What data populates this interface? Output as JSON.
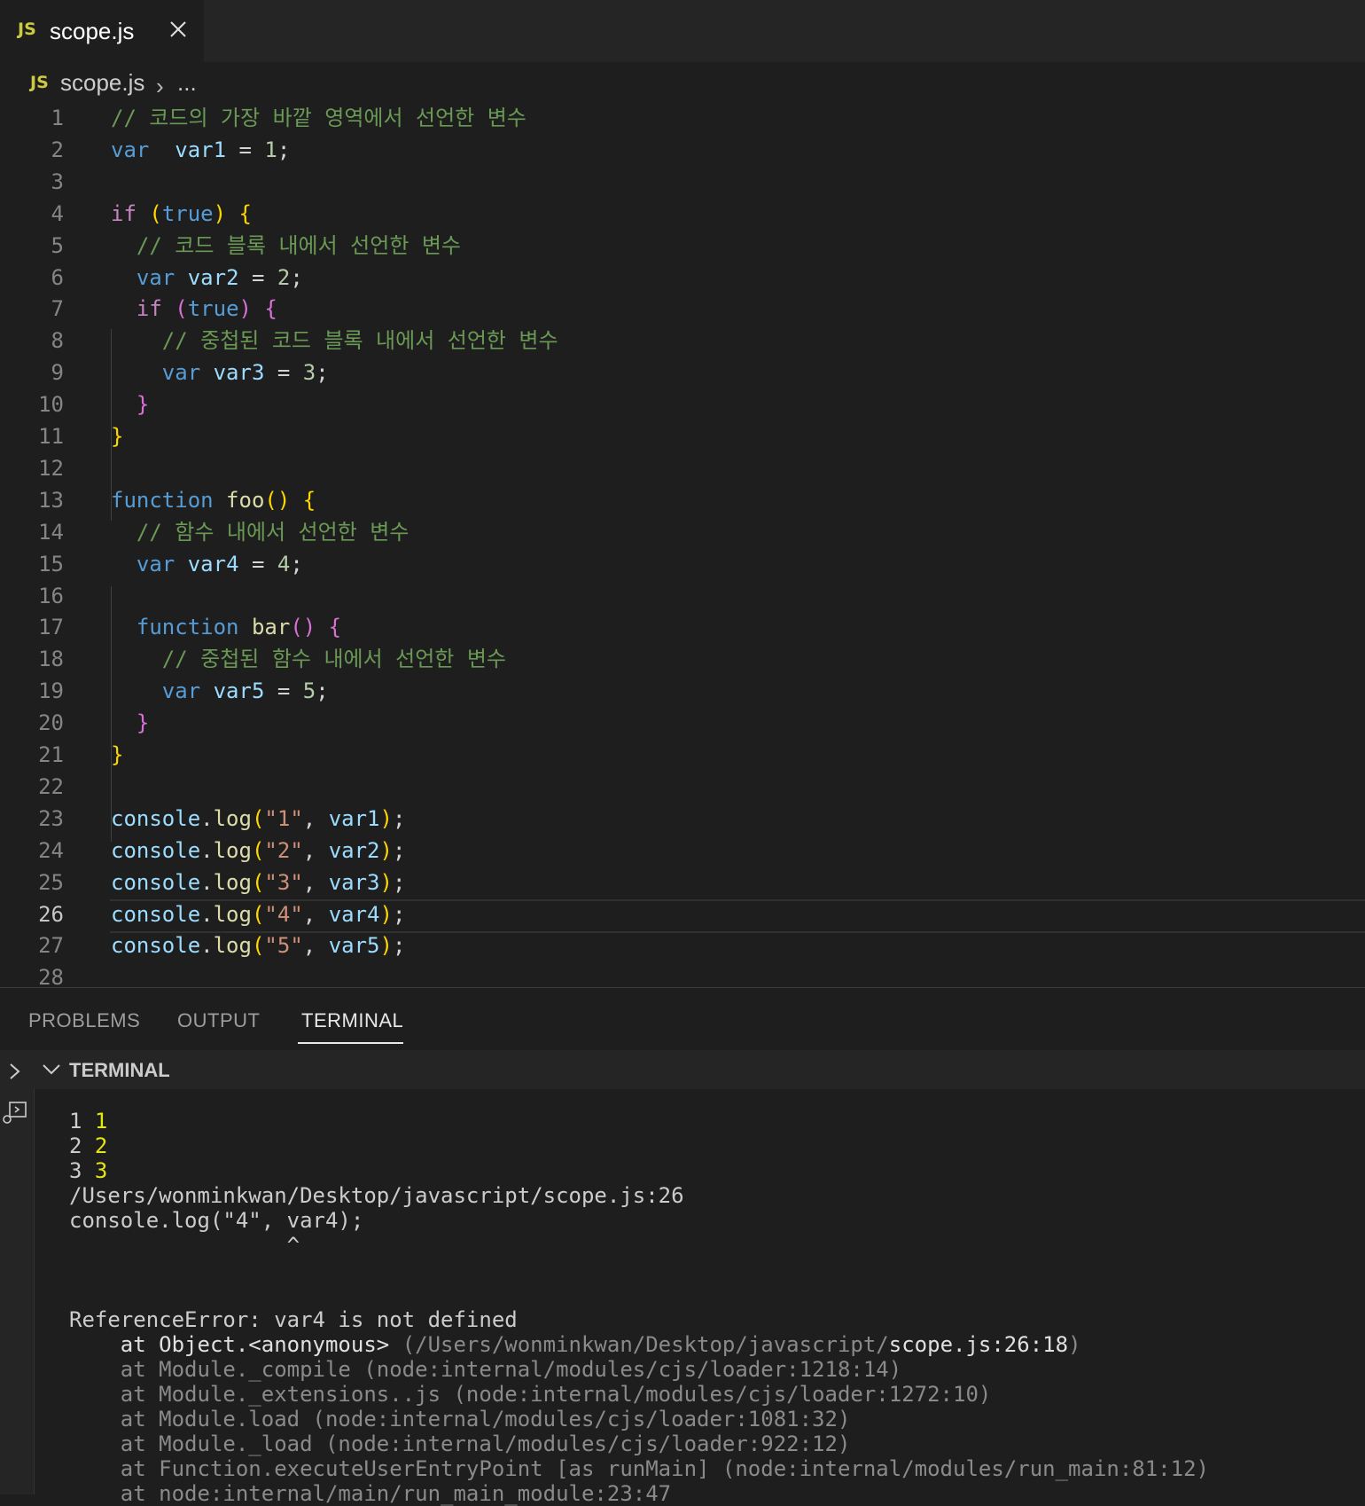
{
  "tab": {
    "badge": "JS",
    "filename": "scope.js"
  },
  "breadcrumb": {
    "badge": "JS",
    "file": "scope.js",
    "chevron": "›",
    "ellipsis": "..."
  },
  "editor": {
    "active_line": 26,
    "lines": [
      {
        "n": "1",
        "segs": [
          [
            "cm",
            "// 코드의 가장 바깥 영역에서 선언한 변수"
          ]
        ]
      },
      {
        "n": "2",
        "segs": [
          [
            "kw",
            "var"
          ],
          [
            "",
            "  "
          ],
          [
            "vr",
            "var1"
          ],
          [
            "",
            " = "
          ],
          [
            "nm",
            "1"
          ],
          [
            "",
            ";"
          ]
        ]
      },
      {
        "n": "3",
        "segs": []
      },
      {
        "n": "4",
        "segs": [
          [
            "ctl",
            "if"
          ],
          [
            "",
            " "
          ],
          [
            "b1",
            "("
          ],
          [
            "kw",
            "true"
          ],
          [
            "b1",
            ")"
          ],
          [
            "",
            " "
          ],
          [
            "b1",
            "{"
          ]
        ]
      },
      {
        "n": "5",
        "segs": [
          [
            "",
            "  "
          ],
          [
            "cm",
            "// 코드 블록 내에서 선언한 변수"
          ]
        ]
      },
      {
        "n": "6",
        "segs": [
          [
            "",
            "  "
          ],
          [
            "kw",
            "var"
          ],
          [
            "",
            " "
          ],
          [
            "vr",
            "var2"
          ],
          [
            "",
            " = "
          ],
          [
            "nm",
            "2"
          ],
          [
            "",
            ";"
          ]
        ]
      },
      {
        "n": "7",
        "segs": [
          [
            "",
            "  "
          ],
          [
            "ctl",
            "if"
          ],
          [
            "",
            " "
          ],
          [
            "b2",
            "("
          ],
          [
            "kw",
            "true"
          ],
          [
            "b2",
            ")"
          ],
          [
            "",
            " "
          ],
          [
            "b2",
            "{"
          ]
        ]
      },
      {
        "n": "8",
        "segs": [
          [
            "",
            "    "
          ],
          [
            "cm",
            "// 중첩된 코드 블록 내에서 선언한 변수"
          ]
        ]
      },
      {
        "n": "9",
        "segs": [
          [
            "",
            "    "
          ],
          [
            "kw",
            "var"
          ],
          [
            "",
            " "
          ],
          [
            "vr",
            "var3"
          ],
          [
            "",
            " = "
          ],
          [
            "nm",
            "3"
          ],
          [
            "",
            ";"
          ]
        ]
      },
      {
        "n": "10",
        "segs": [
          [
            "",
            "  "
          ],
          [
            "b2",
            "}"
          ]
        ]
      },
      {
        "n": "11",
        "segs": [
          [
            "b1",
            "}"
          ]
        ]
      },
      {
        "n": "12",
        "segs": []
      },
      {
        "n": "13",
        "segs": [
          [
            "kw",
            "function"
          ],
          [
            "",
            " "
          ],
          [
            "fn",
            "foo"
          ],
          [
            "b1",
            "()"
          ],
          [
            "",
            " "
          ],
          [
            "b1",
            "{"
          ]
        ]
      },
      {
        "n": "14",
        "segs": [
          [
            "",
            "  "
          ],
          [
            "cm",
            "// 함수 내에서 선언한 변수"
          ]
        ]
      },
      {
        "n": "15",
        "segs": [
          [
            "",
            "  "
          ],
          [
            "kw",
            "var"
          ],
          [
            "",
            " "
          ],
          [
            "vr",
            "var4"
          ],
          [
            "",
            " = "
          ],
          [
            "nm",
            "4"
          ],
          [
            "",
            ";"
          ]
        ]
      },
      {
        "n": "16",
        "segs": []
      },
      {
        "n": "17",
        "segs": [
          [
            "",
            "  "
          ],
          [
            "kw",
            "function"
          ],
          [
            "",
            " "
          ],
          [
            "fn",
            "bar"
          ],
          [
            "b2",
            "()"
          ],
          [
            "",
            " "
          ],
          [
            "b2",
            "{"
          ]
        ]
      },
      {
        "n": "18",
        "segs": [
          [
            "",
            "    "
          ],
          [
            "cm",
            "// 중첩된 함수 내에서 선언한 변수"
          ]
        ]
      },
      {
        "n": "19",
        "segs": [
          [
            "",
            "    "
          ],
          [
            "kw",
            "var"
          ],
          [
            "",
            " "
          ],
          [
            "vr",
            "var5"
          ],
          [
            "",
            " = "
          ],
          [
            "nm",
            "5"
          ],
          [
            "",
            ";"
          ]
        ]
      },
      {
        "n": "20",
        "segs": [
          [
            "",
            "  "
          ],
          [
            "b2",
            "}"
          ]
        ]
      },
      {
        "n": "21",
        "segs": [
          [
            "b1",
            "}"
          ]
        ]
      },
      {
        "n": "22",
        "segs": []
      },
      {
        "n": "23",
        "segs": [
          [
            "vr",
            "console"
          ],
          [
            "",
            "."
          ],
          [
            "fn",
            "log"
          ],
          [
            "b1",
            "("
          ],
          [
            "str",
            "\"1\""
          ],
          [
            "",
            ", "
          ],
          [
            "vr",
            "var1"
          ],
          [
            "b1",
            ")"
          ],
          [
            "",
            ";"
          ]
        ]
      },
      {
        "n": "24",
        "segs": [
          [
            "vr",
            "console"
          ],
          [
            "",
            "."
          ],
          [
            "fn",
            "log"
          ],
          [
            "b1",
            "("
          ],
          [
            "str",
            "\"2\""
          ],
          [
            "",
            ", "
          ],
          [
            "vr",
            "var2"
          ],
          [
            "b1",
            ")"
          ],
          [
            "",
            ";"
          ]
        ]
      },
      {
        "n": "25",
        "segs": [
          [
            "vr",
            "console"
          ],
          [
            "",
            "."
          ],
          [
            "fn",
            "log"
          ],
          [
            "b1",
            "("
          ],
          [
            "str",
            "\"3\""
          ],
          [
            "",
            ", "
          ],
          [
            "vr",
            "var3"
          ],
          [
            "b1",
            ")"
          ],
          [
            "",
            ";"
          ]
        ]
      },
      {
        "n": "26",
        "segs": [
          [
            "vr",
            "console"
          ],
          [
            "",
            "."
          ],
          [
            "fn",
            "log"
          ],
          [
            "b1",
            "("
          ],
          [
            "str",
            "\"4\""
          ],
          [
            "",
            ", "
          ],
          [
            "vr",
            "var4"
          ],
          [
            "b1",
            ")"
          ],
          [
            "",
            ";"
          ]
        ]
      },
      {
        "n": "27",
        "segs": [
          [
            "vr",
            "console"
          ],
          [
            "",
            "."
          ],
          [
            "fn",
            "log"
          ],
          [
            "b1",
            "("
          ],
          [
            "str",
            "\"5\""
          ],
          [
            "",
            ", "
          ],
          [
            "vr",
            "var5"
          ],
          [
            "b1",
            ")"
          ],
          [
            "",
            ";"
          ]
        ]
      },
      {
        "n": "28",
        "segs": []
      }
    ]
  },
  "panel": {
    "tabs": [
      "PROBLEMS",
      "OUTPUT",
      "TERMINAL"
    ],
    "active_tab": "TERMINAL",
    "terminal_header": "TERMINAL"
  },
  "terminal": {
    "lines": [
      [
        [
          "",
          "1 "
        ],
        [
          "yl",
          "1"
        ]
      ],
      [
        [
          "",
          "2 "
        ],
        [
          "yl",
          "2"
        ]
      ],
      [
        [
          "",
          "3 "
        ],
        [
          "yl",
          "3"
        ]
      ],
      [
        [
          "",
          "/Users/wonminkwan/Desktop/javascript/scope.js:26"
        ]
      ],
      [
        [
          "",
          "console.log(\"4\", var4);"
        ]
      ],
      [
        [
          "",
          "                 ^"
        ]
      ],
      [],
      [],
      [
        [
          "",
          "ReferenceError: var4 is not defined"
        ]
      ],
      [
        [
          "white",
          "    at Object.<anonymous> "
        ],
        [
          "dim",
          "(/Users/wonminkwan/Desktop/javascript/"
        ],
        [
          "white",
          "scope.js:26:18"
        ],
        [
          "dim",
          ")"
        ]
      ],
      [
        [
          "dim",
          "    at Module._compile (node:internal/modules/cjs/loader:1218:14)"
        ]
      ],
      [
        [
          "dim",
          "    at Module._extensions..js (node:internal/modules/cjs/loader:1272:10)"
        ]
      ],
      [
        [
          "dim",
          "    at Module.load (node:internal/modules/cjs/loader:1081:32)"
        ]
      ],
      [
        [
          "dim",
          "    at Module._load (node:internal/modules/cjs/loader:922:12)"
        ]
      ],
      [
        [
          "dim",
          "    at Function.executeUserEntryPoint [as runMain] (node:internal/modules/run_main:81:12)"
        ]
      ],
      [
        [
          "dim",
          "    at node:internal/main/run_main_module:23:47"
        ]
      ]
    ]
  }
}
